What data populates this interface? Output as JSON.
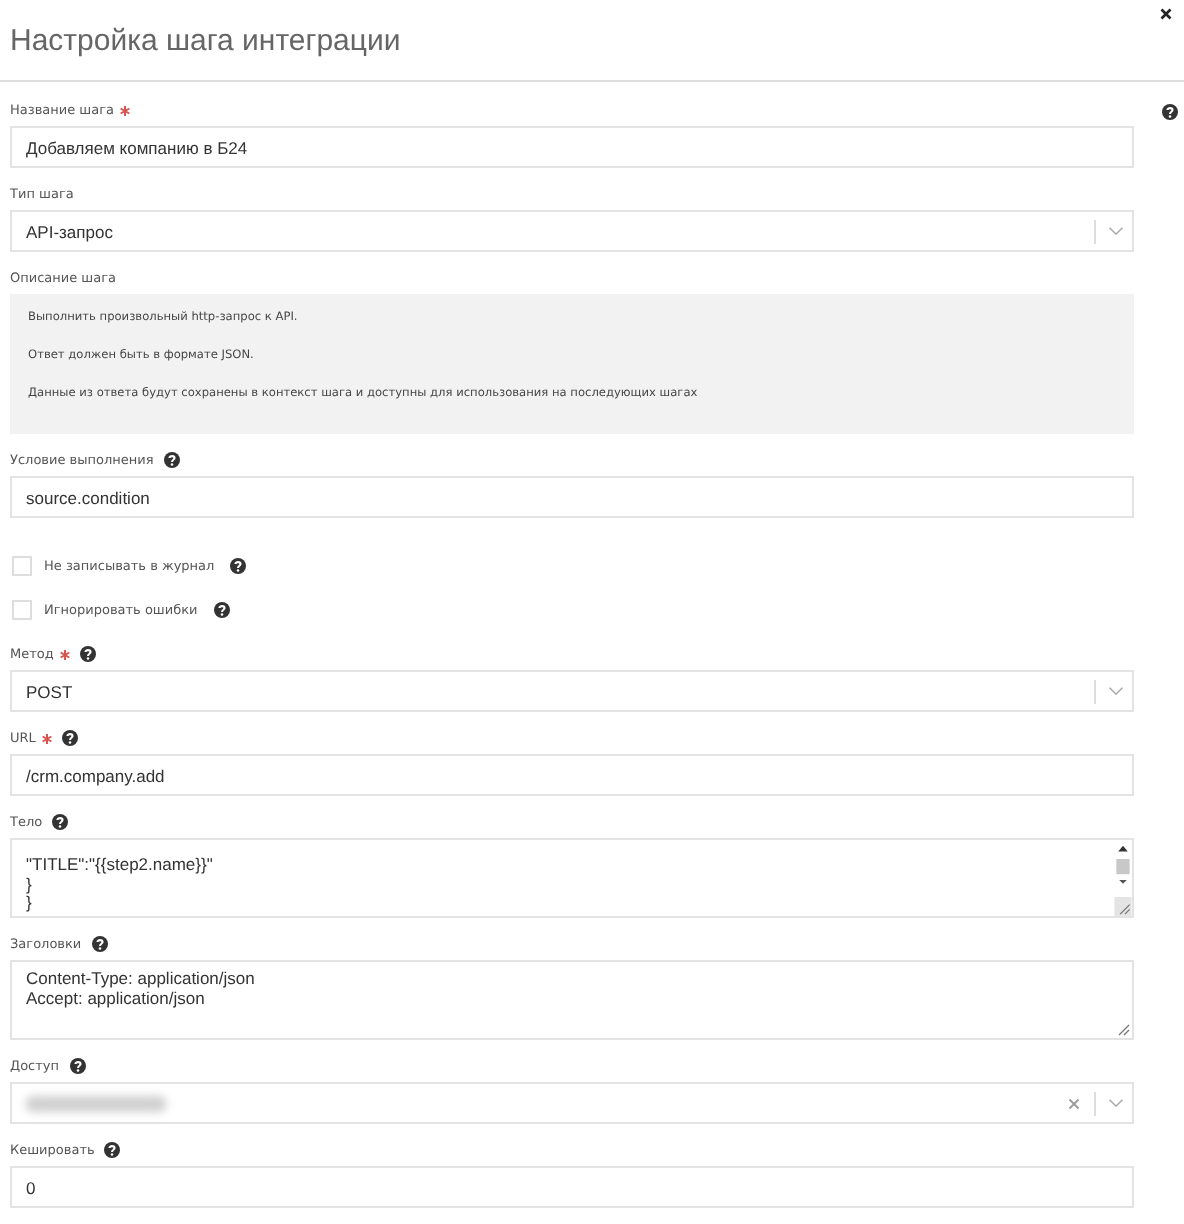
{
  "dialog": {
    "title": "Настройка шага интеграции",
    "closable": true,
    "help": true
  },
  "fields": [
    {
      "kind": "text",
      "label": "Название шага",
      "required": true,
      "help": false,
      "value": "Добавляем компанию в Б24"
    },
    {
      "kind": "select",
      "label": "Тип шага",
      "required": false,
      "help": false,
      "value": "API-запрос",
      "clearable": false
    },
    {
      "kind": "description",
      "label": "Описание шага",
      "lines": [
        "Выполнить произвольный http-запрос к API.",
        "Ответ должен быть в формате JSON.",
        "Данные из ответа будут сохранены в контекст шага и доступны для использования на последующих шагах"
      ]
    },
    {
      "kind": "text",
      "label": "Условие выполнения",
      "required": false,
      "help": true,
      "value": "source.condition"
    },
    {
      "kind": "checkbox",
      "label": "Не записывать в журнал",
      "help": true,
      "checked": false
    },
    {
      "kind": "checkbox",
      "label": "Игнорировать ошибки",
      "help": true,
      "checked": false
    },
    {
      "kind": "select",
      "label": "Метод",
      "required": true,
      "help": true,
      "value": "POST",
      "clearable": false
    },
    {
      "kind": "text",
      "label": "URL",
      "required": true,
      "help": true,
      "value": "/crm.company.add"
    },
    {
      "kind": "textarea",
      "label": "Тело",
      "required": false,
      "help": true,
      "lines": [
        "\"TITLE\":\"{{step2.name}}\"",
        "}",
        "}"
      ],
      "scrollbar": true
    },
    {
      "kind": "textarea",
      "label": "Заголовки",
      "required": false,
      "help": true,
      "lines": [
        "Content-Type: application/json",
        "Accept: application/json"
      ],
      "scrollbar": false
    },
    {
      "kind": "select",
      "label": "Доступ",
      "required": false,
      "help": true,
      "redacted": true,
      "clearable": true
    },
    {
      "kind": "text",
      "label": "Кешировать",
      "required": false,
      "help": true,
      "value": "0"
    }
  ]
}
